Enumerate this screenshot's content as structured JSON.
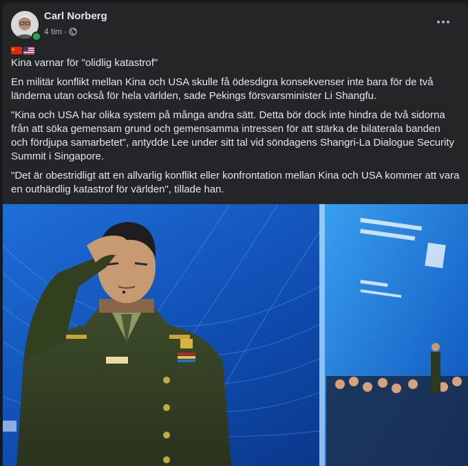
{
  "post": {
    "author": "Carl Norberg",
    "time": "4 tim",
    "separator": "·",
    "flags": [
      "china-flag-icon",
      "usa-flag-icon"
    ],
    "headline": "Kina varnar för \"olidlig katastrof\"",
    "paragraphs": [
      "En militär konflikt mellan Kina och USA skulle få ödesdigra konsekvenser inte bara för de två länderna utan också för hela världen, sade Pekings försvarsminister Li Shangfu.",
      "\"Kina och USA har olika system på många andra sätt. Detta bör dock inte hindra de två sidorna från att söka gemensam grund och gemensamma intressen för att stärka de bilaterala banden och fördjupa samarbetet\", antydde Lee under sitt tal vid söndagens Shangri-La Dialogue Security Summit i Singapore.",
      "\"Det är obestridligt att en allvarlig konflikt eller konfrontation mellan Kina och USA kommer att vara en outhärdlig katastrof för världen\", tillade han."
    ]
  },
  "colors": {
    "background": "#18191a",
    "card": "#242526",
    "text_primary": "#e4e6eb",
    "text_secondary": "#b0b3b8",
    "online": "#31a24c"
  }
}
